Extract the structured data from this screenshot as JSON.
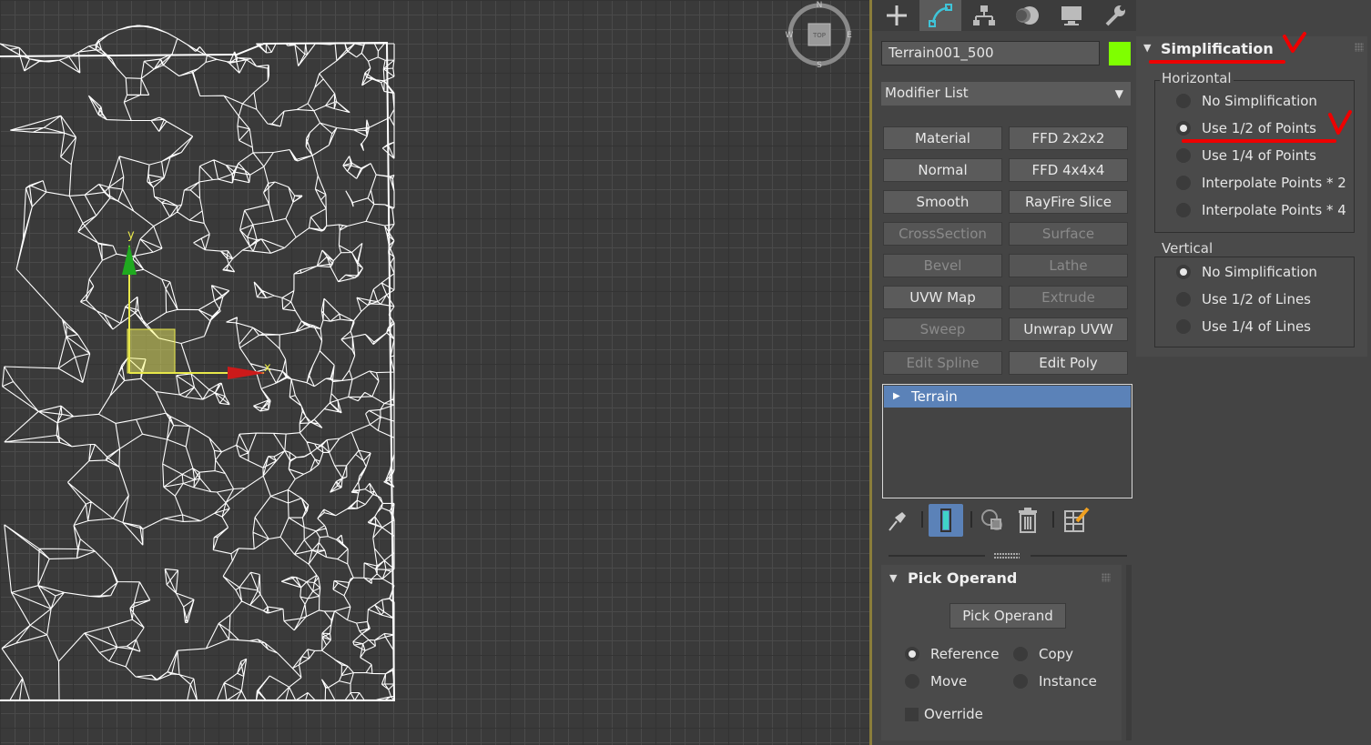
{
  "viewport": {
    "axis_y_label": "y",
    "axis_x_label": "x",
    "viewcube": {
      "label": "TOP",
      "north": "N",
      "south": "S",
      "east": "E",
      "west": "W"
    },
    "wire_color": "#ffffff",
    "gizmo_color": "#ffff66"
  },
  "command_panel": {
    "tabs": [
      {
        "icon": "create-plus-icon"
      },
      {
        "icon": "modify-icon",
        "active": true
      },
      {
        "icon": "hierarchy-icon"
      },
      {
        "icon": "motion-icon"
      },
      {
        "icon": "display-icon"
      },
      {
        "icon": "utilities-wrench-icon"
      }
    ],
    "object_name": "Terrain001_500",
    "object_color": "#7fff00",
    "modifier_list_label": "Modifier List",
    "modifier_buttons": [
      {
        "label": "Material",
        "enabled": true
      },
      {
        "label": "FFD 2x2x2",
        "enabled": true
      },
      {
        "label": "Normal",
        "enabled": true
      },
      {
        "label": "FFD 4x4x4",
        "enabled": true
      },
      {
        "label": "Smooth",
        "enabled": true
      },
      {
        "label": "RayFire Slice",
        "enabled": true
      },
      {
        "label": "CrossSection",
        "enabled": false
      },
      {
        "label": "Surface",
        "enabled": false
      },
      {
        "label": "Bevel",
        "enabled": false
      },
      {
        "label": "Lathe",
        "enabled": false
      },
      {
        "label": "UVW Map",
        "enabled": true
      },
      {
        "label": "Extrude",
        "enabled": false
      },
      {
        "label": "Sweep",
        "enabled": false
      },
      {
        "label": "Unwrap UVW",
        "enabled": true
      },
      {
        "label": "Edit Spline",
        "enabled": false
      },
      {
        "label": "Edit Poly",
        "enabled": true
      }
    ],
    "stack": {
      "selected_item": "Terrain"
    },
    "pick_operand": {
      "title": "Pick Operand",
      "button_label": "Pick Operand",
      "options": {
        "reference": "Reference",
        "copy": "Copy",
        "move": "Move",
        "instance": "Instance"
      },
      "selected": "reference",
      "override_label": "Override",
      "override_checked": false
    }
  },
  "simplification": {
    "title": "Simplification",
    "horizontal": {
      "label": "Horizontal",
      "options": [
        "No Simplification",
        "Use 1/2 of Points",
        "Use 1/4 of Points",
        "Interpolate Points * 2",
        "Interpolate Points * 4"
      ],
      "selected_index": 1
    },
    "vertical": {
      "label": "Vertical",
      "options": [
        "No Simplification",
        "Use 1/2 of Lines",
        "Use 1/4 of Lines"
      ],
      "selected_index": 0
    },
    "annotation_color": "#e00000"
  }
}
